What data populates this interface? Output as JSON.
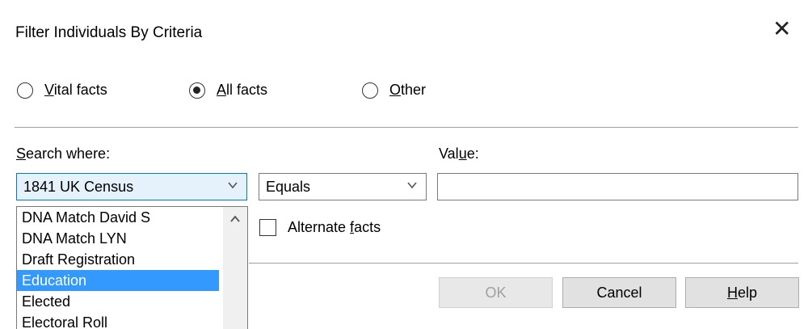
{
  "window": {
    "title": "Filter Individuals By Criteria",
    "close_glyph": "✕"
  },
  "radios": [
    {
      "label_prefix": "",
      "label_accel": "V",
      "label_rest": "ital facts",
      "checked": false
    },
    {
      "label_prefix": "",
      "label_accel": "A",
      "label_rest": "ll facts",
      "checked": true
    },
    {
      "label_prefix": "",
      "label_accel": "O",
      "label_rest": "ther",
      "checked": false
    }
  ],
  "search": {
    "label_accel": "S",
    "label_rest": "earch where:",
    "selected": "1841 UK Census"
  },
  "operator": {
    "selected": "Equals"
  },
  "value": {
    "label_prefix": "Val",
    "label_accel": "u",
    "label_rest": "e:",
    "text": ""
  },
  "dropdown": {
    "items": [
      "DNA Match David S",
      "DNA Match LYN",
      "Draft Registration",
      "Education",
      "Elected",
      "Electoral Roll"
    ],
    "selected_index": 3
  },
  "alternate": {
    "label_prefix": "Alternate ",
    "label_accel": "f",
    "label_rest": "acts",
    "checked": false
  },
  "buttons": {
    "ok": "OK",
    "cancel": "Cancel",
    "help_accel": "H",
    "help_rest": "elp"
  },
  "icons": {
    "close": "close-icon",
    "dropdown": "chevron-down-icon",
    "scroll_up": "chevron-up-icon"
  }
}
